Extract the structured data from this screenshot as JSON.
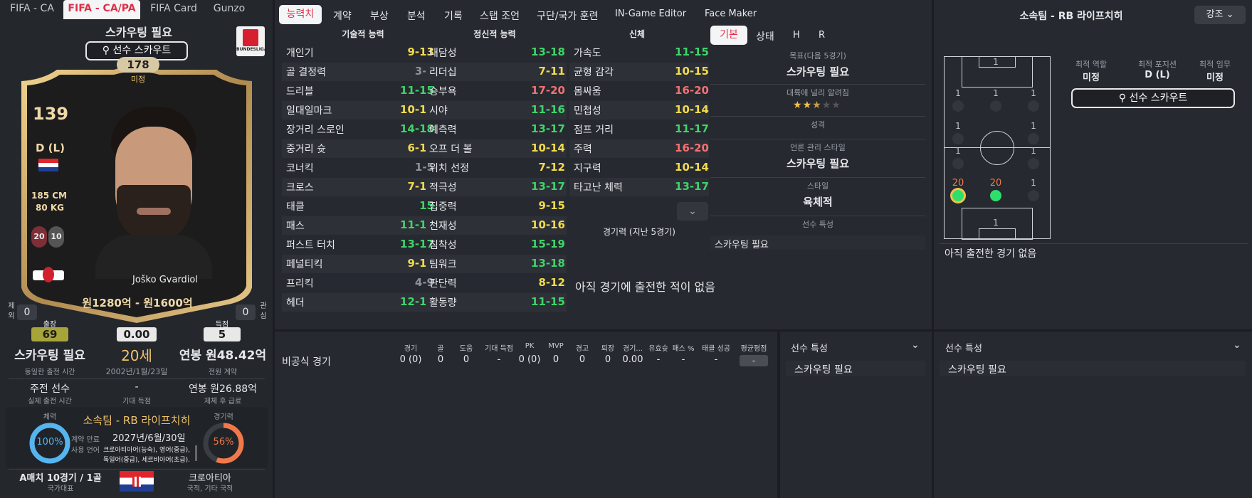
{
  "top_tabs": [
    "FIFA - CA",
    "FIFA - CA/PA",
    "FIFA Card",
    "Gunzo"
  ],
  "main_tabs": [
    "능력치",
    "계약",
    "부상",
    "분석",
    "기록",
    "스탭 조언",
    "구단/국가 훈련",
    "IN-Game Editor",
    "Face Maker"
  ],
  "card": {
    "scout_title": "스카우팅 필요",
    "scout_button": "선수 스카우트",
    "ca": "178",
    "ca_sub": "미정",
    "rating": "139",
    "position": "D (L)",
    "height": "185 CM",
    "weight": "80 KG",
    "foot_left": "20",
    "foot_right": "10",
    "name": "Joško Gvardiol",
    "value": "원1280억 - 원1600억",
    "left_side_label": "제외",
    "left_side_val": "0",
    "right_side_label": "관심",
    "right_side_val": "0",
    "league_logo": "BUNDESLIGA",
    "colors": {
      "gold": "#c9a45a",
      "accent": "#f0c36a"
    }
  },
  "stats_bar": {
    "apps_label": "출장",
    "apps": "69",
    "rating": "0.00",
    "goals_label": "득점",
    "goals": "5"
  },
  "info": {
    "col1_main": "스카우팅 필요",
    "col1_sub": "동일한 출전 시간",
    "age": "20세",
    "dob": "2002년/1월/23일",
    "wage": "연봉 원48.42억",
    "wage_sub": "전원 계약",
    "role": "주전 선수",
    "role_sub": "실제 출전 시간",
    "exp_goals": "-",
    "exp_goals_sub": "기대 득점",
    "wage2": "연봉 원26.88억",
    "wage2_sub": "제체 후 급료"
  },
  "club_box": {
    "fitness_label": "체력",
    "fitness": "100%",
    "club": "소속팀 - RB 라이프치히",
    "contract_label": "계약 만료",
    "contract": "2027년/6월/30일",
    "lang_label": "사용 언어",
    "languages_1": "크로아티아어(능숙), 영어(중급),",
    "languages_2": "독일어(중급), 세르비아어(초급).",
    "sharpness_label": "경기력",
    "sharpness": "56%"
  },
  "national": {
    "caps": "A매치 10경기 / 1골",
    "caps_sub": "국가대표",
    "country": "크로아티아",
    "country_sub": "국적, 기타 국적"
  },
  "attr_headers": [
    "기술적 능력",
    "정신적 능력",
    "신체"
  ],
  "technical": [
    {
      "name": "개인기",
      "val": "9-13",
      "c": "yellow"
    },
    {
      "name": "골 결정력",
      "val": "3-8",
      "c": "gray"
    },
    {
      "name": "드리블",
      "val": "11-15",
      "c": "green"
    },
    {
      "name": "일대일마크",
      "val": "10-16",
      "c": "yellow"
    },
    {
      "name": "장거리 스로인",
      "val": "14-18",
      "c": "green"
    },
    {
      "name": "중거리 슛",
      "val": "6-10",
      "c": "yellow"
    },
    {
      "name": "코너킥",
      "val": "1-5",
      "c": "gray"
    },
    {
      "name": "크로스",
      "val": "7-11",
      "c": "yellow"
    },
    {
      "name": "태클",
      "val": "15",
      "c": "green"
    },
    {
      "name": "패스",
      "val": "11-15",
      "c": "green"
    },
    {
      "name": "퍼스트 터치",
      "val": "13-17",
      "c": "green"
    },
    {
      "name": "페널티킥",
      "val": "9-13",
      "c": "yellow"
    },
    {
      "name": "프리킥",
      "val": "4-9",
      "c": "gray"
    },
    {
      "name": "헤더",
      "val": "12-17",
      "c": "green"
    }
  ],
  "mental": [
    {
      "name": "대담성",
      "val": "13-18",
      "c": "green"
    },
    {
      "name": "리더십",
      "val": "7-11",
      "c": "yellow"
    },
    {
      "name": "승부욕",
      "val": "17-20",
      "c": "red"
    },
    {
      "name": "시야",
      "val": "11-16",
      "c": "green"
    },
    {
      "name": "예측력",
      "val": "13-17",
      "c": "green"
    },
    {
      "name": "오프 더 볼",
      "val": "10-14",
      "c": "yellow"
    },
    {
      "name": "위치 선정",
      "val": "7-12",
      "c": "yellow"
    },
    {
      "name": "적극성",
      "val": "13-17",
      "c": "green"
    },
    {
      "name": "집중력",
      "val": "9-15",
      "c": "yellow"
    },
    {
      "name": "천재성",
      "val": "10-16",
      "c": "yellow"
    },
    {
      "name": "침착성",
      "val": "15-19",
      "c": "green"
    },
    {
      "name": "팀워크",
      "val": "13-18",
      "c": "green"
    },
    {
      "name": "판단력",
      "val": "8-12",
      "c": "yellow"
    },
    {
      "name": "활동량",
      "val": "11-15",
      "c": "green"
    }
  ],
  "physical": [
    {
      "name": "가속도",
      "val": "11-15",
      "c": "green"
    },
    {
      "name": "균형 감각",
      "val": "10-15",
      "c": "yellow"
    },
    {
      "name": "몸싸움",
      "val": "16-20",
      "c": "red"
    },
    {
      "name": "민첩성",
      "val": "10-14",
      "c": "yellow"
    },
    {
      "name": "점프 거리",
      "val": "11-17",
      "c": "green"
    },
    {
      "name": "주력",
      "val": "16-20",
      "c": "red"
    },
    {
      "name": "지구력",
      "val": "10-14",
      "c": "yellow"
    },
    {
      "name": "타고난 체력",
      "val": "13-17",
      "c": "green"
    }
  ],
  "form_label": "경기력 (지난 5경기)",
  "no_games": "아직 경기에 출전한 적이 없음",
  "side_tabs": [
    "기본",
    "상태",
    "H",
    "R"
  ],
  "side_info": [
    {
      "label": "목표(다음 5경기)",
      "value": "스카우팅 필요"
    },
    {
      "label": "대륙에 널리 알려짐",
      "value": ""
    },
    {
      "label": "성격",
      "value": ""
    },
    {
      "label": "언론 관리 스타일",
      "value": "스카우팅 필요"
    },
    {
      "label": "스타일",
      "value": "육체적"
    },
    {
      "label": "선수 특성",
      "value": ""
    }
  ],
  "reputation_stars": 2.5,
  "side_trait": "스카우팅 필요",
  "right": {
    "title": "소속팀 - RB 라이프치히",
    "highlight_btn": "강조",
    "best_role_label": "최적 역할",
    "best_role": "미정",
    "best_pos_label": "최적 포지션",
    "best_pos": "D (L)",
    "best_duty_label": "최적 임무",
    "best_duty": "미정",
    "scout_btn": "선수 스카우트",
    "no_games": "아직 출전한 경기 없음",
    "pitch_numbers": [
      "1",
      "1",
      "1",
      "1",
      "1",
      "1",
      "1",
      "1",
      "1",
      "1",
      "20",
      "20",
      "1",
      "1"
    ]
  },
  "match_table": {
    "headers": [
      "경기",
      "골",
      "도움",
      "기대 득점",
      "PK",
      "MVP",
      "경고",
      "퇴장",
      "경기...",
      "유효슛",
      "패스 %",
      "태클 성공",
      "평균평점"
    ],
    "row_label": "비공식 경기",
    "row": [
      "0 (0)",
      "0",
      "0",
      "-",
      "0 (0)",
      "0",
      "0",
      "0",
      "0.00",
      "-",
      "-",
      "-",
      "-"
    ]
  },
  "traits_panel_1": {
    "title": "선수 특성",
    "value": "스카우팅 필요"
  },
  "traits_panel_2": {
    "title": "선수 특성",
    "value": "스카우팅 필요"
  }
}
